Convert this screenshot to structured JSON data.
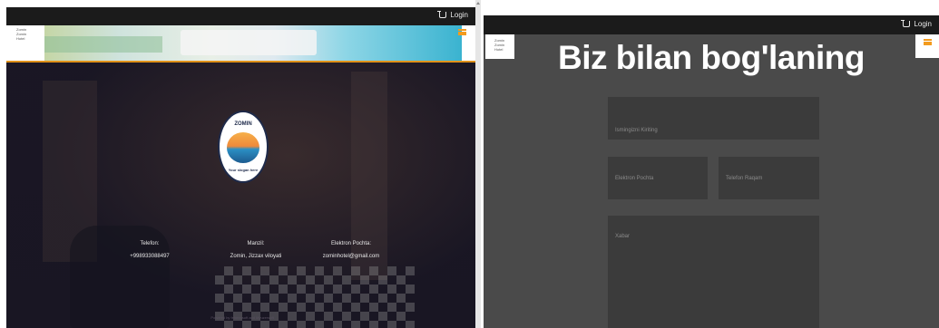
{
  "left": {
    "topbar": {
      "login_label": "Login",
      "cart_icon": "cart-icon"
    },
    "header": {
      "brand": "Zomin\nZomin\nHotel",
      "menu_icon": "hamburger-icon",
      "accent_color": "#e0921a"
    },
    "logo": {
      "top_text": "ZOMIN",
      "bottom_text": "Your slogan here"
    },
    "footer": {
      "phone_label": "Telefon:",
      "phone_value": "+998933088497",
      "address_label": "Manzil:",
      "address_value": "Zomin, Jizzax viloyati",
      "email_label": "Elektron Pochta:",
      "email_value": "zominhotel@gmail.com",
      "copyright": "Powered by fehmmsoft and Myuzersoft"
    }
  },
  "right": {
    "topbar": {
      "login_label": "Login"
    },
    "brand": "Zomin\nZomin\nHotel",
    "title": "Biz bilan bog'laning",
    "form": {
      "name_placeholder": "Ismingizni Kiriting",
      "email_placeholder": "Elektron Pochta",
      "phone_placeholder": "Telefon Raqam",
      "message_placeholder": "Xabar"
    }
  }
}
